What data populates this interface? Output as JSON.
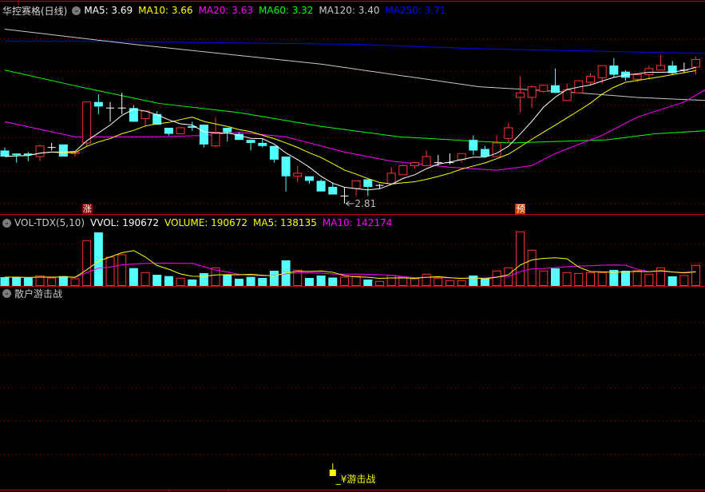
{
  "header": {
    "title": "华控赛格(日线)",
    "ma5": "MA5: 3.69",
    "ma10": "MA10: 3.66",
    "ma20": "MA20: 3.63",
    "ma60": "MA60: 3.32",
    "ma120": "MA120: 3.40",
    "ma250": "MA250: 3.71"
  },
  "volume_header": {
    "title": "VOL-TDX(5,10)",
    "vvol": "VVOL: 190672",
    "volume": "VOLUME: 190672",
    "ma5": "MA5: 138135",
    "ma10": "MA10: 142174"
  },
  "indicator_header": {
    "title": "散户游击战"
  },
  "colors": {
    "up": "#ff3232",
    "down": "#54ffff",
    "doji": "#ffffff",
    "ma5": "#ffffff",
    "ma10": "#ffff00",
    "ma20": "#ff00ff",
    "ma60": "#00ff00",
    "ma120": "#c8c8c8",
    "ma250": "#0000ff",
    "grid": "#a00000",
    "border": "#c80000"
  },
  "chart_data": [
    {
      "type": "candlestick",
      "title": "华控赛格(日线)",
      "ylim": [
        2.741,
        4.047
      ],
      "ohlc": [
        [
          3.16,
          3.18,
          3.12,
          3.12
        ],
        [
          3.14,
          3.14,
          3.08,
          3.13
        ],
        [
          3.14,
          3.15,
          3.09,
          3.13
        ],
        [
          3.12,
          3.2,
          3.09,
          3.19
        ],
        [
          3.18,
          3.21,
          3.16,
          3.18
        ],
        [
          3.2,
          3.2,
          3.12,
          3.12
        ],
        [
          3.14,
          3.15,
          3.12,
          3.15
        ],
        [
          3.21,
          3.48,
          3.19,
          3.48
        ],
        [
          3.48,
          3.53,
          3.4,
          3.45
        ],
        [
          3.44,
          3.48,
          3.35,
          3.44
        ],
        [
          3.44,
          3.54,
          3.4,
          3.44
        ],
        [
          3.44,
          3.46,
          3.35,
          3.35
        ],
        [
          3.37,
          3.42,
          3.32,
          3.42
        ],
        [
          3.4,
          3.42,
          3.33,
          3.33
        ],
        [
          3.31,
          3.31,
          3.26,
          3.27
        ],
        [
          3.27,
          3.31,
          3.27,
          3.31
        ],
        [
          3.32,
          3.35,
          3.29,
          3.31
        ],
        [
          3.33,
          3.33,
          3.18,
          3.2
        ],
        [
          3.19,
          3.38,
          3.18,
          3.28
        ],
        [
          3.31,
          3.31,
          3.22,
          3.28
        ],
        [
          3.27,
          3.28,
          3.23,
          3.23
        ],
        [
          3.23,
          3.23,
          3.16,
          3.21
        ],
        [
          3.21,
          3.24,
          3.18,
          3.19
        ],
        [
          3.19,
          3.19,
          3.08,
          3.1
        ],
        [
          3.12,
          3.12,
          2.89,
          2.99
        ],
        [
          2.99,
          3.06,
          2.95,
          3.01
        ],
        [
          2.99,
          2.99,
          2.94,
          2.96
        ],
        [
          2.96,
          2.97,
          2.89,
          2.89
        ],
        [
          2.92,
          2.95,
          2.87,
          2.87
        ],
        [
          2.86,
          2.92,
          2.81,
          2.86
        ],
        [
          2.91,
          2.96,
          2.86,
          2.96
        ],
        [
          2.97,
          2.97,
          2.86,
          2.92
        ],
        [
          2.93,
          2.94,
          2.91,
          2.93
        ],
        [
          2.94,
          3.05,
          2.94,
          3.01
        ],
        [
          3.0,
          3.07,
          3.0,
          3.06
        ],
        [
          3.06,
          3.08,
          3.04,
          3.08
        ],
        [
          3.06,
          3.16,
          3.06,
          3.12
        ],
        [
          3.08,
          3.13,
          3.06,
          3.08
        ],
        [
          3.08,
          3.14,
          3.07,
          3.08
        ],
        [
          3.1,
          3.14,
          3.08,
          3.14
        ],
        [
          3.23,
          3.26,
          3.13,
          3.16
        ],
        [
          3.17,
          3.19,
          3.12,
          3.12
        ],
        [
          3.12,
          3.26,
          3.12,
          3.21
        ],
        [
          3.24,
          3.34,
          3.21,
          3.31
        ],
        [
          3.51,
          3.65,
          3.41,
          3.54
        ],
        [
          3.51,
          3.59,
          3.44,
          3.58
        ],
        [
          3.55,
          3.59,
          3.54,
          3.59
        ],
        [
          3.59,
          3.7,
          3.54,
          3.54
        ],
        [
          3.49,
          3.6,
          3.49,
          3.56
        ],
        [
          3.54,
          3.62,
          3.54,
          3.62
        ],
        [
          3.61,
          3.67,
          3.59,
          3.65
        ],
        [
          3.64,
          3.72,
          3.6,
          3.72
        ],
        [
          3.72,
          3.77,
          3.64,
          3.66
        ],
        [
          3.68,
          3.69,
          3.62,
          3.64
        ],
        [
          3.63,
          3.66,
          3.61,
          3.66
        ],
        [
          3.66,
          3.72,
          3.63,
          3.7
        ],
        [
          3.69,
          3.79,
          3.69,
          3.72
        ],
        [
          3.72,
          3.75,
          3.66,
          3.67
        ],
        [
          3.69,
          3.74,
          3.67,
          3.69
        ],
        [
          3.71,
          3.78,
          3.66,
          3.76
        ]
      ],
      "ma_series": {
        "ma20": [
          [
            0,
            3.35
          ],
          [
            3,
            3.3
          ],
          [
            6,
            3.25
          ],
          [
            13,
            3.25
          ],
          [
            17,
            3.26
          ],
          [
            20,
            3.28
          ],
          [
            24,
            3.25
          ],
          [
            29,
            3.15
          ],
          [
            33,
            3.09
          ],
          [
            38,
            3.05
          ],
          [
            42,
            3.03
          ],
          [
            45,
            3.06
          ],
          [
            47,
            3.14
          ],
          [
            51,
            3.26
          ],
          [
            54,
            3.38
          ],
          [
            58,
            3.48
          ],
          [
            59.8,
            3.56
          ]
        ],
        "ma60": [
          [
            0,
            3.69
          ],
          [
            6.4,
            3.58
          ],
          [
            13.2,
            3.47
          ],
          [
            20,
            3.41
          ],
          [
            26.9,
            3.32
          ],
          [
            33.7,
            3.25
          ],
          [
            40.5,
            3.22
          ],
          [
            43.2,
            3.21
          ],
          [
            47.3,
            3.22
          ],
          [
            51.4,
            3.23
          ],
          [
            55.5,
            3.27
          ],
          [
            59.8,
            3.29
          ]
        ],
        "ma120": [
          [
            0,
            3.96
          ],
          [
            11,
            3.86
          ],
          [
            27,
            3.73
          ],
          [
            40.5,
            3.58
          ],
          [
            45,
            3.56
          ],
          [
            49,
            3.54
          ],
          [
            54,
            3.51
          ],
          [
            59.8,
            3.49
          ]
        ],
        "ma250": [
          [
            0,
            3.88
          ],
          [
            8,
            3.88
          ],
          [
            30,
            3.86
          ],
          [
            41,
            3.83
          ],
          [
            59.8,
            3.8
          ]
        ]
      },
      "low_label": {
        "index": 29,
        "value": "2.81"
      },
      "markers": [
        {
          "index": 7,
          "label": "涨",
          "color": "#8b0000"
        },
        {
          "index": 44,
          "label": "预",
          "color": "#c04000"
        }
      ]
    },
    {
      "type": "bar",
      "title": "VOL-TDX(5,10)",
      "ylim": [
        0,
        541000
      ],
      "values": [
        81600,
        81600,
        74200,
        94200,
        74200,
        91300,
        66800,
        420700,
        497100,
        267100,
        289400,
        165500,
        123900,
        103900,
        91300,
        72000,
        59400,
        118700,
        168400,
        103900,
        66800,
        83800,
        74200,
        141000,
        237400,
        146200,
        74200,
        96500,
        77900,
        81600,
        89000,
        59400,
        42300,
        98700,
        83800,
        66800,
        109100,
        72000,
        49700,
        49700,
        96500,
        66800,
        138800,
        168400,
        502300,
        331700,
        138800,
        163200,
        123900,
        116500,
        123900,
        123900,
        148400,
        141000,
        141000,
        109100,
        168400,
        89000,
        96500,
        190672
      ]
    },
    {
      "type": "signal",
      "title": "散户游击战",
      "signals": [
        {
          "index": 28,
          "label": "_¥游击战"
        }
      ]
    }
  ]
}
